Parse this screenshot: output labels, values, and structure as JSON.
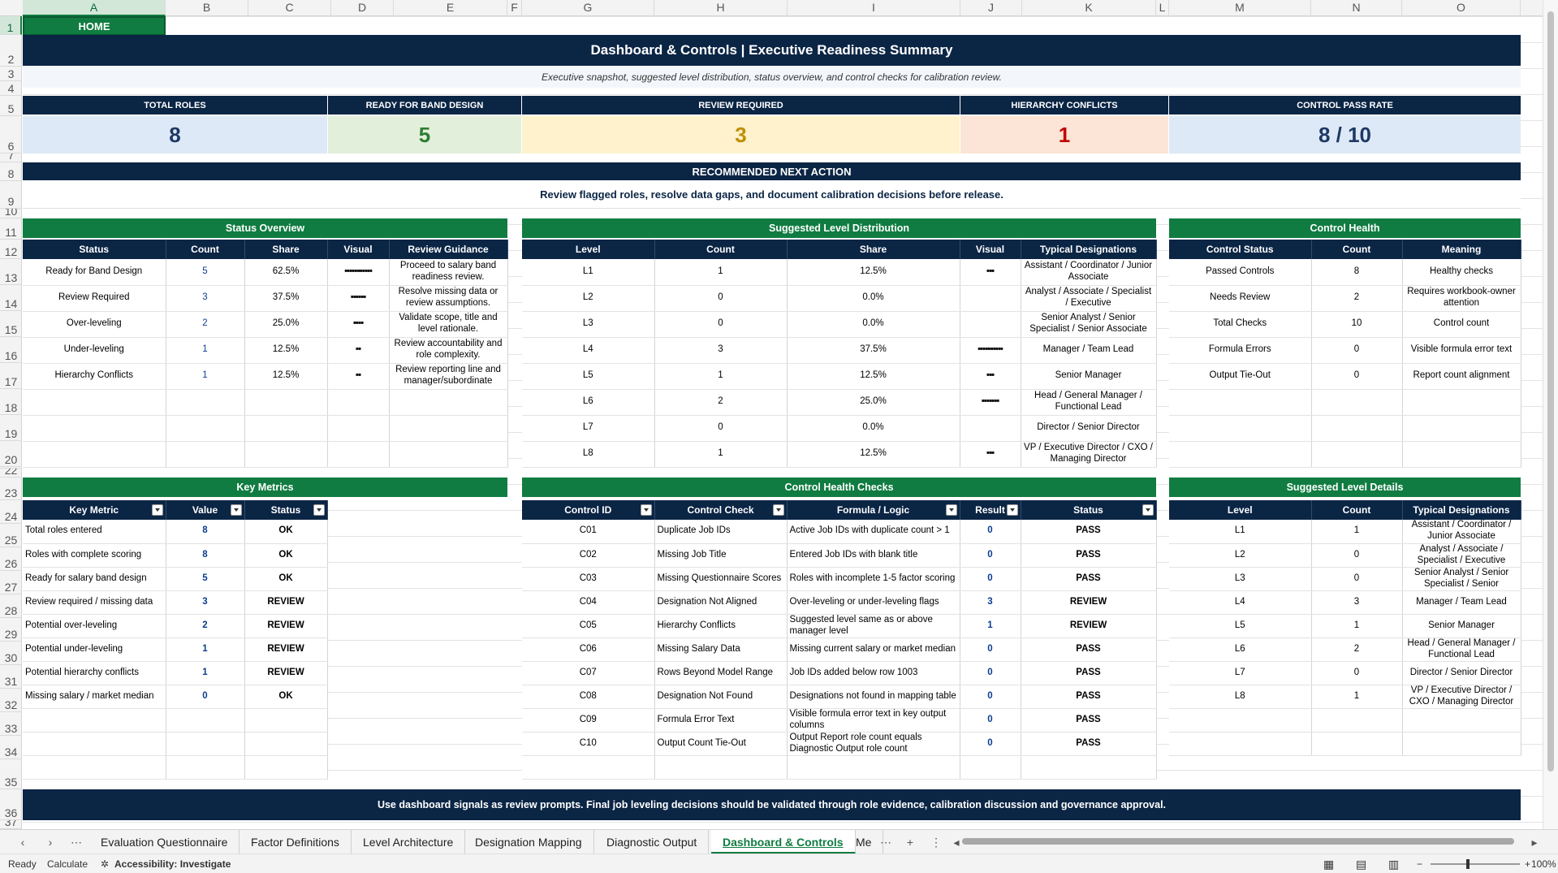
{
  "columns": [
    "A",
    "B",
    "C",
    "D",
    "E",
    "F",
    "G",
    "H",
    "I",
    "J",
    "K",
    "L",
    "M",
    "N",
    "O"
  ],
  "rows": [
    "1",
    "2",
    "3",
    "4",
    "5",
    "6",
    "7",
    "8",
    "9",
    "10",
    "11",
    "12",
    "13",
    "14",
    "15",
    "16",
    "17",
    "18",
    "19",
    "20",
    "21",
    "22",
    "23",
    "24",
    "25",
    "26",
    "27",
    "28",
    "29",
    "30",
    "31",
    "32",
    "33",
    "34",
    "35",
    "36",
    "37"
  ],
  "home_label": "HOME",
  "title": "Dashboard & Controls | Executive Readiness Summary",
  "subtitle": "Executive snapshot, suggested level distribution, status overview, and control checks for calibration review.",
  "kpis": [
    {
      "label": "TOTAL ROLES",
      "value": "8",
      "bg": "#dde9f6",
      "fg": "#1f3864"
    },
    {
      "label": "READY FOR BAND DESIGN",
      "value": "5",
      "bg": "#e2efda",
      "fg": "#2e7d32"
    },
    {
      "label": "REVIEW REQUIRED",
      "value": "3",
      "bg": "#fff2cc",
      "fg": "#bf8f00"
    },
    {
      "label": "HIERARCHY CONFLICTS",
      "value": "1",
      "bg": "#fce4d6",
      "fg": "#c00000"
    },
    {
      "label": "CONTROL PASS RATE",
      "value": "8 / 10",
      "bg": "#dde9f6",
      "fg": "#1f3864"
    }
  ],
  "recommendation": {
    "title": "RECOMMENDED NEXT ACTION",
    "text": "Review flagged roles, resolve data gaps, and document calibration decisions before release."
  },
  "status_overview": {
    "title": "Status Overview",
    "headers": [
      "Status",
      "Count",
      "Share",
      "Visual",
      "Review Guidance"
    ],
    "rows": [
      {
        "status": "Ready for Band Design",
        "count": "5",
        "share": "62.5%",
        "visual": "▪▪▪▪▪▪▪▪▪▪▪",
        "guidance": "Proceed to salary band readiness review."
      },
      {
        "status": "Review Required",
        "count": "3",
        "share": "37.5%",
        "visual": "▪▪▪▪▪▪",
        "guidance": "Resolve missing data or review assumptions."
      },
      {
        "status": "Over-leveling",
        "count": "2",
        "share": "25.0%",
        "visual": "▪▪▪▪",
        "guidance": "Validate scope, title and level rationale."
      },
      {
        "status": "Under-leveling",
        "count": "1",
        "share": "12.5%",
        "visual": "▪▪",
        "guidance": "Review accountability and role complexity."
      },
      {
        "status": "Hierarchy Conflicts",
        "count": "1",
        "share": "12.5%",
        "visual": "▪▪",
        "guidance": "Review reporting line and manager/subordinate"
      }
    ]
  },
  "level_distribution": {
    "title": "Suggested Level Distribution",
    "headers": [
      "Level",
      "Count",
      "Share",
      "Visual",
      "Typical Designations"
    ],
    "rows": [
      {
        "level": "L1",
        "count": "1",
        "share": "12.5%",
        "visual": "▪▪▪",
        "designations": "Assistant / Coordinator / Junior Associate"
      },
      {
        "level": "L2",
        "count": "0",
        "share": "0.0%",
        "visual": "",
        "designations": "Analyst / Associate / Specialist / Executive"
      },
      {
        "level": "L3",
        "count": "0",
        "share": "0.0%",
        "visual": "",
        "designations": "Senior Analyst / Senior Specialist / Senior Associate"
      },
      {
        "level": "L4",
        "count": "3",
        "share": "37.5%",
        "visual": "▪▪▪▪▪▪▪▪▪▪",
        "designations": "Manager / Team Lead"
      },
      {
        "level": "L5",
        "count": "1",
        "share": "12.5%",
        "visual": "▪▪▪",
        "designations": "Senior Manager"
      },
      {
        "level": "L6",
        "count": "2",
        "share": "25.0%",
        "visual": "▪▪▪▪▪▪▪",
        "designations": "Head / General Manager / Functional Lead"
      },
      {
        "level": "L7",
        "count": "0",
        "share": "0.0%",
        "visual": "",
        "designations": "Director / Senior Director"
      },
      {
        "level": "L8",
        "count": "1",
        "share": "12.5%",
        "visual": "▪▪▪",
        "designations": "VP / Executive Director / CXO / Managing Director"
      }
    ]
  },
  "control_health": {
    "title": "Control Health",
    "headers": [
      "Control Status",
      "Count",
      "Meaning"
    ],
    "rows": [
      {
        "status": "Passed Controls",
        "count": "8",
        "meaning": "Healthy checks"
      },
      {
        "status": "Needs Review",
        "count": "2",
        "meaning": "Requires workbook-owner attention"
      },
      {
        "status": "Total Checks",
        "count": "10",
        "meaning": "Control count"
      },
      {
        "status": "Formula Errors",
        "count": "0",
        "meaning": "Visible formula error text"
      },
      {
        "status": "Output Tie-Out",
        "count": "0",
        "meaning": "Report count alignment"
      }
    ]
  },
  "key_metrics": {
    "title": "Key Metrics",
    "headers": [
      "Key Metric",
      "Value",
      "Status"
    ],
    "rows": [
      {
        "metric": "Total roles entered",
        "value": "8",
        "status": "OK"
      },
      {
        "metric": "Roles with complete scoring",
        "value": "8",
        "status": "OK"
      },
      {
        "metric": "Ready for salary band design",
        "value": "5",
        "status": "OK"
      },
      {
        "metric": "Review required / missing data",
        "value": "3",
        "status": "REVIEW"
      },
      {
        "metric": "Potential over-leveling",
        "value": "2",
        "status": "REVIEW"
      },
      {
        "metric": "Potential under-leveling",
        "value": "1",
        "status": "REVIEW"
      },
      {
        "metric": "Potential hierarchy conflicts",
        "value": "1",
        "status": "REVIEW"
      },
      {
        "metric": "Missing salary / market median",
        "value": "0",
        "status": "OK"
      }
    ]
  },
  "control_checks": {
    "title": "Control Health Checks",
    "headers": [
      "Control ID",
      "Control Check",
      "Formula / Logic",
      "Result",
      "Status"
    ],
    "rows": [
      {
        "id": "C01",
        "check": "Duplicate Job IDs",
        "logic": "Active Job IDs with duplicate count > 1",
        "result": "0",
        "status": "PASS"
      },
      {
        "id": "C02",
        "check": "Missing Job Title",
        "logic": "Entered Job IDs with blank title",
        "result": "0",
        "status": "PASS"
      },
      {
        "id": "C03",
        "check": "Missing Questionnaire Scores",
        "logic": "Roles with incomplete 1-5 factor scoring",
        "result": "0",
        "status": "PASS"
      },
      {
        "id": "C04",
        "check": "Designation Not Aligned",
        "logic": "Over-leveling or under-leveling flags",
        "result": "3",
        "status": "REVIEW"
      },
      {
        "id": "C05",
        "check": "Hierarchy Conflicts",
        "logic": "Suggested level same as or above manager level",
        "result": "1",
        "status": "REVIEW"
      },
      {
        "id": "C06",
        "check": "Missing Salary Data",
        "logic": "Missing current salary or market median",
        "result": "0",
        "status": "PASS"
      },
      {
        "id": "C07",
        "check": "Rows Beyond Model Range",
        "logic": "Job IDs added below row 1003",
        "result": "0",
        "status": "PASS"
      },
      {
        "id": "C08",
        "check": "Designation Not Found",
        "logic": "Designations not found in mapping table",
        "result": "0",
        "status": "PASS"
      },
      {
        "id": "C09",
        "check": "Formula Error Text",
        "logic": "Visible formula error text in key output columns",
        "result": "0",
        "status": "PASS"
      },
      {
        "id": "C10",
        "check": "Output Count Tie-Out",
        "logic": "Output Report role count equals Diagnostic Output role count",
        "result": "0",
        "status": "PASS"
      }
    ]
  },
  "level_details": {
    "title": "Suggested Level Details",
    "headers": [
      "Level",
      "Count",
      "Typical Designations"
    ],
    "rows": [
      {
        "level": "L1",
        "count": "1",
        "designations": "Assistant / Coordinator / Junior Associate"
      },
      {
        "level": "L2",
        "count": "0",
        "designations": "Analyst / Associate / Specialist / Executive"
      },
      {
        "level": "L3",
        "count": "0",
        "designations": "Senior Analyst / Senior Specialist / Senior"
      },
      {
        "level": "L4",
        "count": "3",
        "designations": "Manager / Team Lead"
      },
      {
        "level": "L5",
        "count": "1",
        "designations": "Senior Manager"
      },
      {
        "level": "L6",
        "count": "2",
        "designations": "Head / General Manager / Functional Lead"
      },
      {
        "level": "L7",
        "count": "0",
        "designations": "Director / Senior Director"
      },
      {
        "level": "L8",
        "count": "1",
        "designations": "VP / Executive Director / CXO / Managing Director"
      }
    ]
  },
  "footer": "Use dashboard signals as review prompts. Final job leveling decisions should be validated through role evidence, calibration discussion and governance approval.",
  "sheet_tabs": {
    "tabs": [
      "Evaluation Questionnaire",
      "Factor Definitions",
      "Level Architecture",
      "Designation Mapping",
      "Diagnostic Output",
      "Dashboard & Controls",
      "Me"
    ],
    "active": "Dashboard & Controls"
  },
  "status_bar": {
    "ready": "Ready",
    "calculate": "Calculate",
    "accessibility": "Accessibility: Investigate",
    "zoom": "100%"
  },
  "colors": {
    "navy": "#0b2545",
    "green": "#107c41",
    "accent_blue": "#0b3d91"
  }
}
